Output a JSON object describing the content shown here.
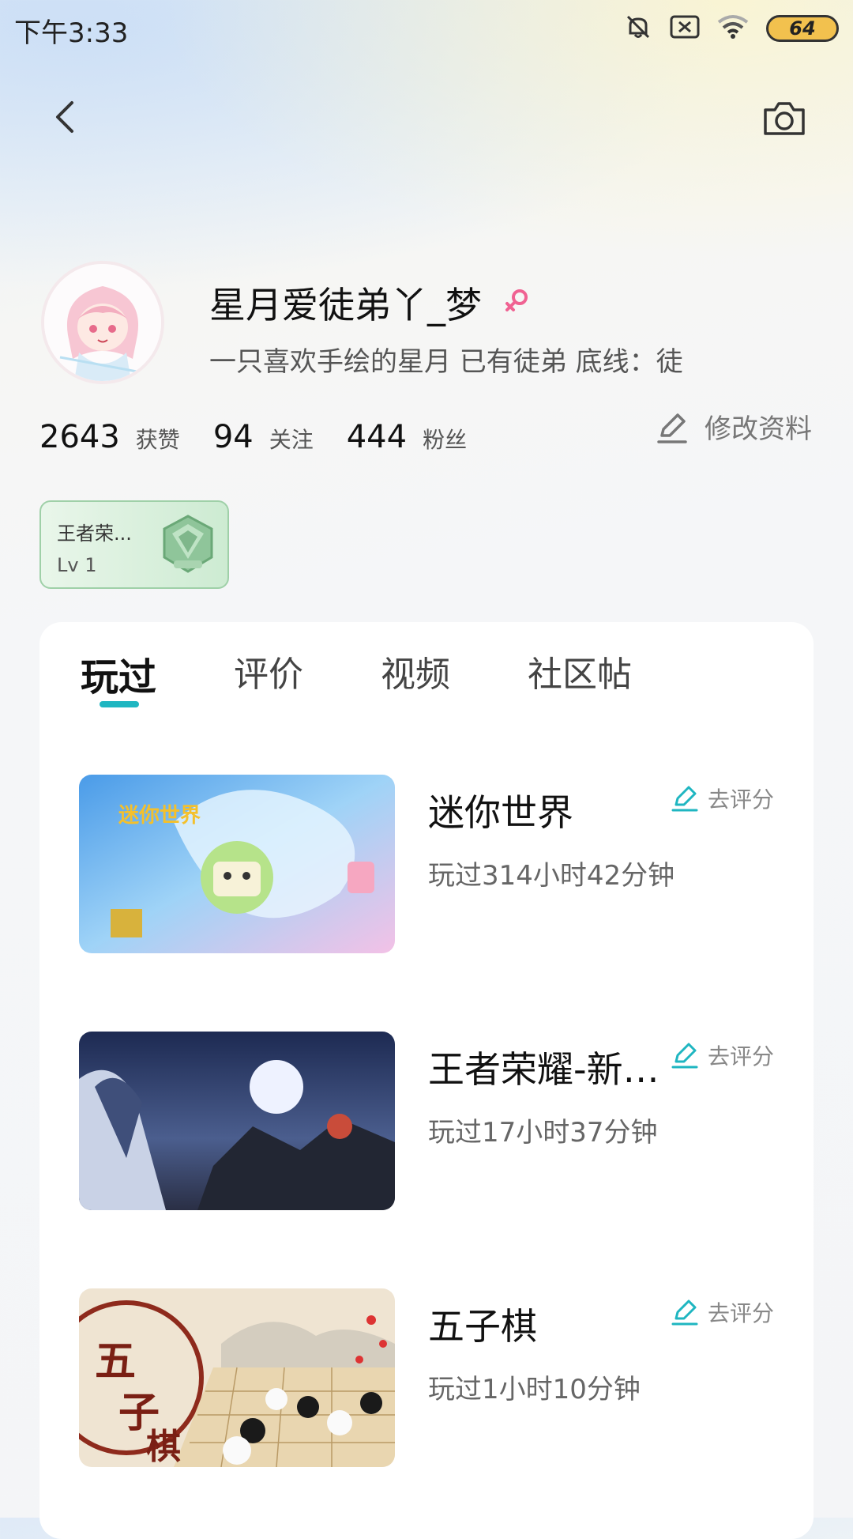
{
  "status_bar": {
    "time": "下午3:33",
    "battery": "64"
  },
  "profile": {
    "username": "星月爱徒弟丫_梦",
    "bio": "一只喜欢手绘的星月  已有徒弟 底线：徒",
    "stats": [
      {
        "value": "2643",
        "label": "获赞"
      },
      {
        "value": "94",
        "label": "关注"
      },
      {
        "value": "444",
        "label": "粉丝"
      }
    ],
    "edit_label": "修改资料"
  },
  "badge": {
    "name": "王者荣...",
    "level": "Lv 1"
  },
  "tabs": [
    {
      "label": "玩过",
      "active": true
    },
    {
      "label": "评价",
      "active": false
    },
    {
      "label": "视频",
      "active": false
    },
    {
      "label": "社区帖",
      "active": false
    }
  ],
  "games": [
    {
      "title": "迷你世界",
      "playtime": "玩过314小时42分钟",
      "rate_label": "去评分"
    },
    {
      "title": "王者荣耀-新版本",
      "playtime": "玩过17小时37分钟",
      "rate_label": "去评分"
    },
    {
      "title": "五子棋",
      "playtime": "玩过1小时10分钟",
      "rate_label": "去评分"
    }
  ],
  "colors": {
    "accent": "#1fb6c1",
    "female_symbol": "#f06292"
  }
}
